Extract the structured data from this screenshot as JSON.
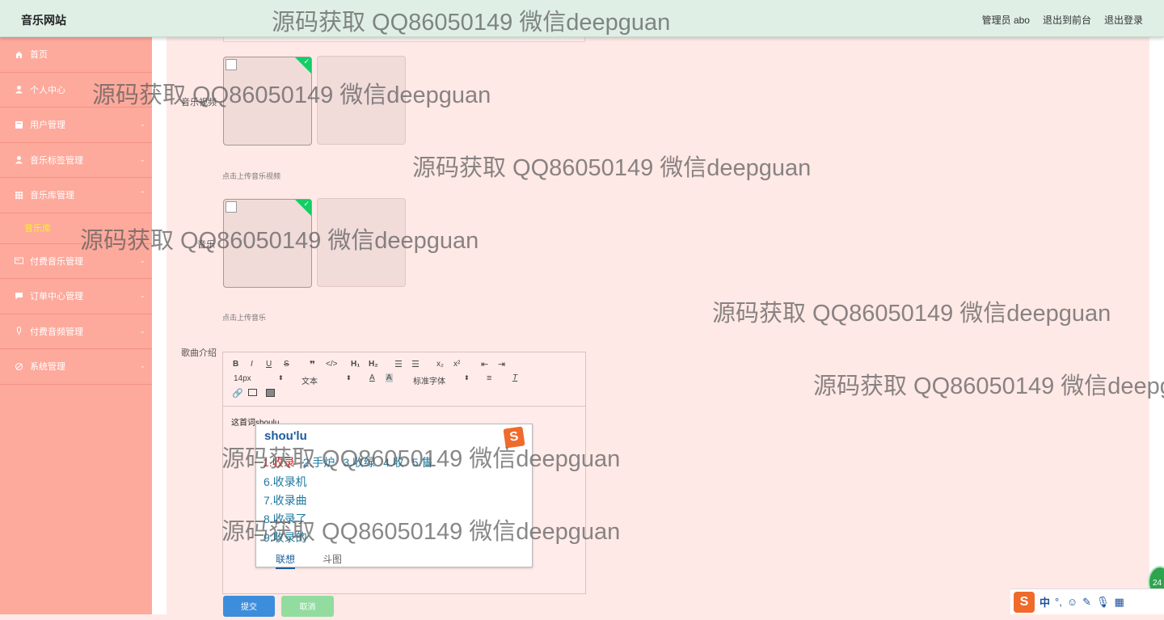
{
  "header": {
    "site_title": "音乐网站",
    "admin_label": "管理员 abo",
    "back_to_front": "退出到前台",
    "logout": "退出登录"
  },
  "sidebar": {
    "items": [
      {
        "label": "首页",
        "icon": "home-icon"
      },
      {
        "label": "个人中心",
        "icon": "user-icon"
      },
      {
        "label": "用户管理",
        "icon": "book-icon"
      },
      {
        "label": "音乐标签管理",
        "icon": "user-icon"
      },
      {
        "label": "音乐库管理",
        "icon": "grid-icon"
      },
      {
        "label": "付费音乐管理",
        "icon": "card-icon"
      },
      {
        "label": "订单中心管理",
        "icon": "chat-icon"
      },
      {
        "label": "付费音频管理",
        "icon": "mic-icon"
      },
      {
        "label": "系统管理",
        "icon": "settings-icon"
      }
    ],
    "sub_item": "音乐库"
  },
  "form": {
    "video_label": "音乐视频",
    "video_hint": "点击上传音乐视频",
    "music_label": "音乐",
    "music_hint": "点击上传音乐",
    "intro_label": "歌曲介绍"
  },
  "editor": {
    "font_size": "14px",
    "paragraph": "文本",
    "font_family": "标准字体",
    "content": "这首词shoulu"
  },
  "ime": {
    "input": "shou'lu",
    "row1": [
      "1.收录",
      "2.手炉",
      "3.收绿",
      "4.收",
      "5.售"
    ],
    "list": [
      "6.收录机",
      "7.收录曲",
      "8.收录了",
      "9.收录的"
    ],
    "tab_active": "联想",
    "tab_other": "斗图",
    "logo": "S"
  },
  "buttons": {
    "submit": "提交",
    "cancel": "取消"
  },
  "watermark": "源码获取 QQ86050149 微信deepguan",
  "tray": {
    "lang": "中",
    "punct": "°,",
    "badge": "24"
  },
  "colors": {
    "sidebar_bg": "#fda99c",
    "topbar_bg": "#dfefe6",
    "main_bg": "#ffe9e6",
    "submit_blue": "#3c8ddc",
    "cancel_green": "#92dca0",
    "check_green": "#13ce66"
  }
}
